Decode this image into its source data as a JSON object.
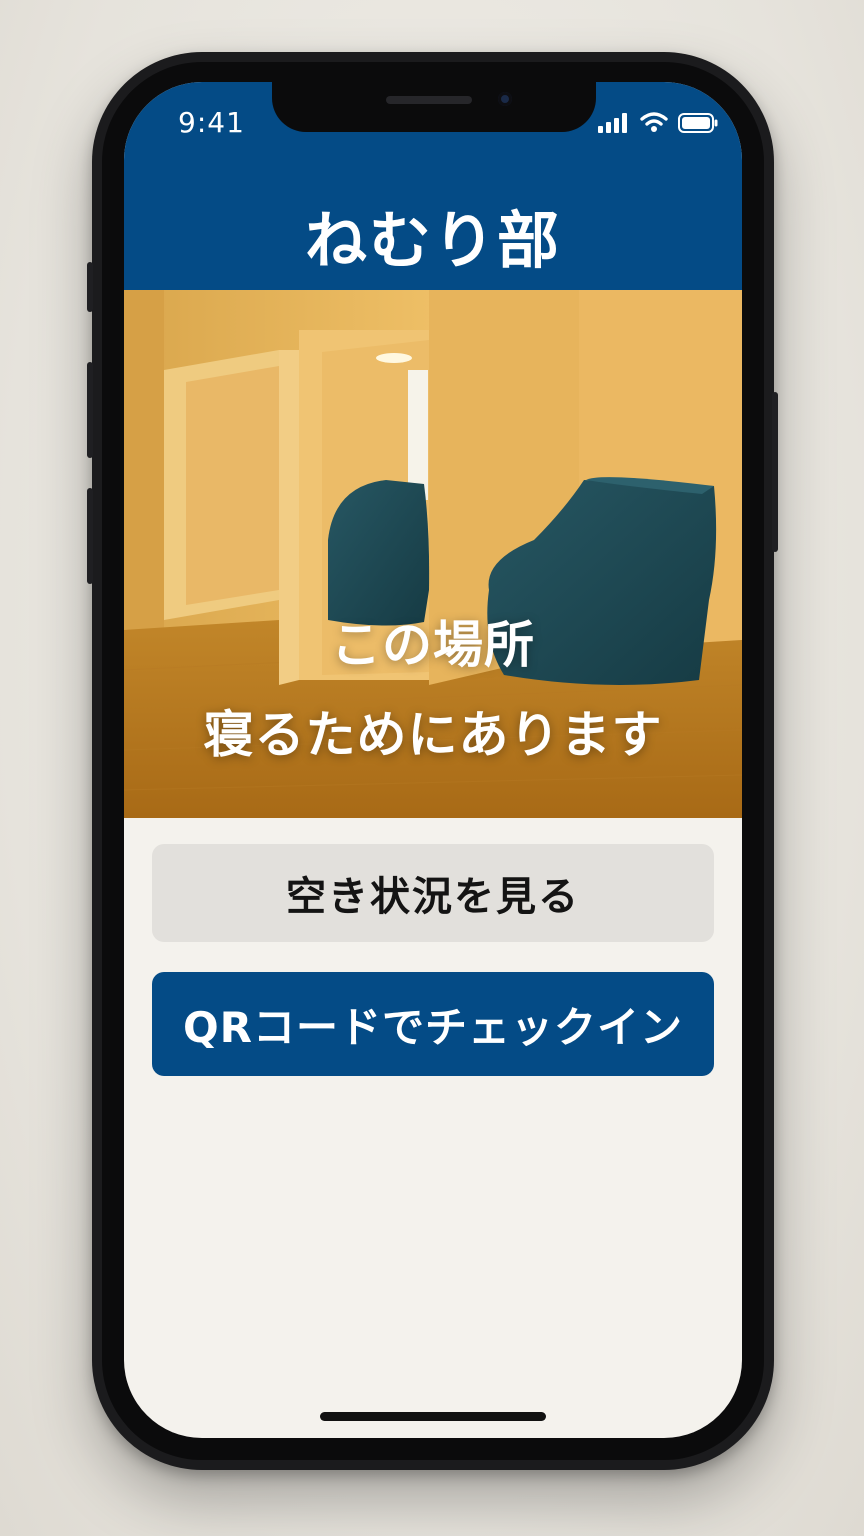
{
  "status_bar": {
    "time": "9:41",
    "icons": [
      "cellular-signal-icon",
      "wifi-icon",
      "battery-icon"
    ]
  },
  "header": {
    "title": "ねむり部"
  },
  "hero": {
    "image": "nap-room-photo",
    "caption_line1": "この場所",
    "caption_line2": "寝るためにあります"
  },
  "actions": {
    "availability_label": "空き状況を見る",
    "checkin_label": "QRコードでチェックイン"
  },
  "colors": {
    "brand_blue": "#044b86",
    "secondary_button": "#e2e0dc",
    "screen_background": "#f4f2ed",
    "room_wall": "#e9b95f",
    "room_floor": "#b67a1f",
    "cushion": "#1f4a54"
  }
}
